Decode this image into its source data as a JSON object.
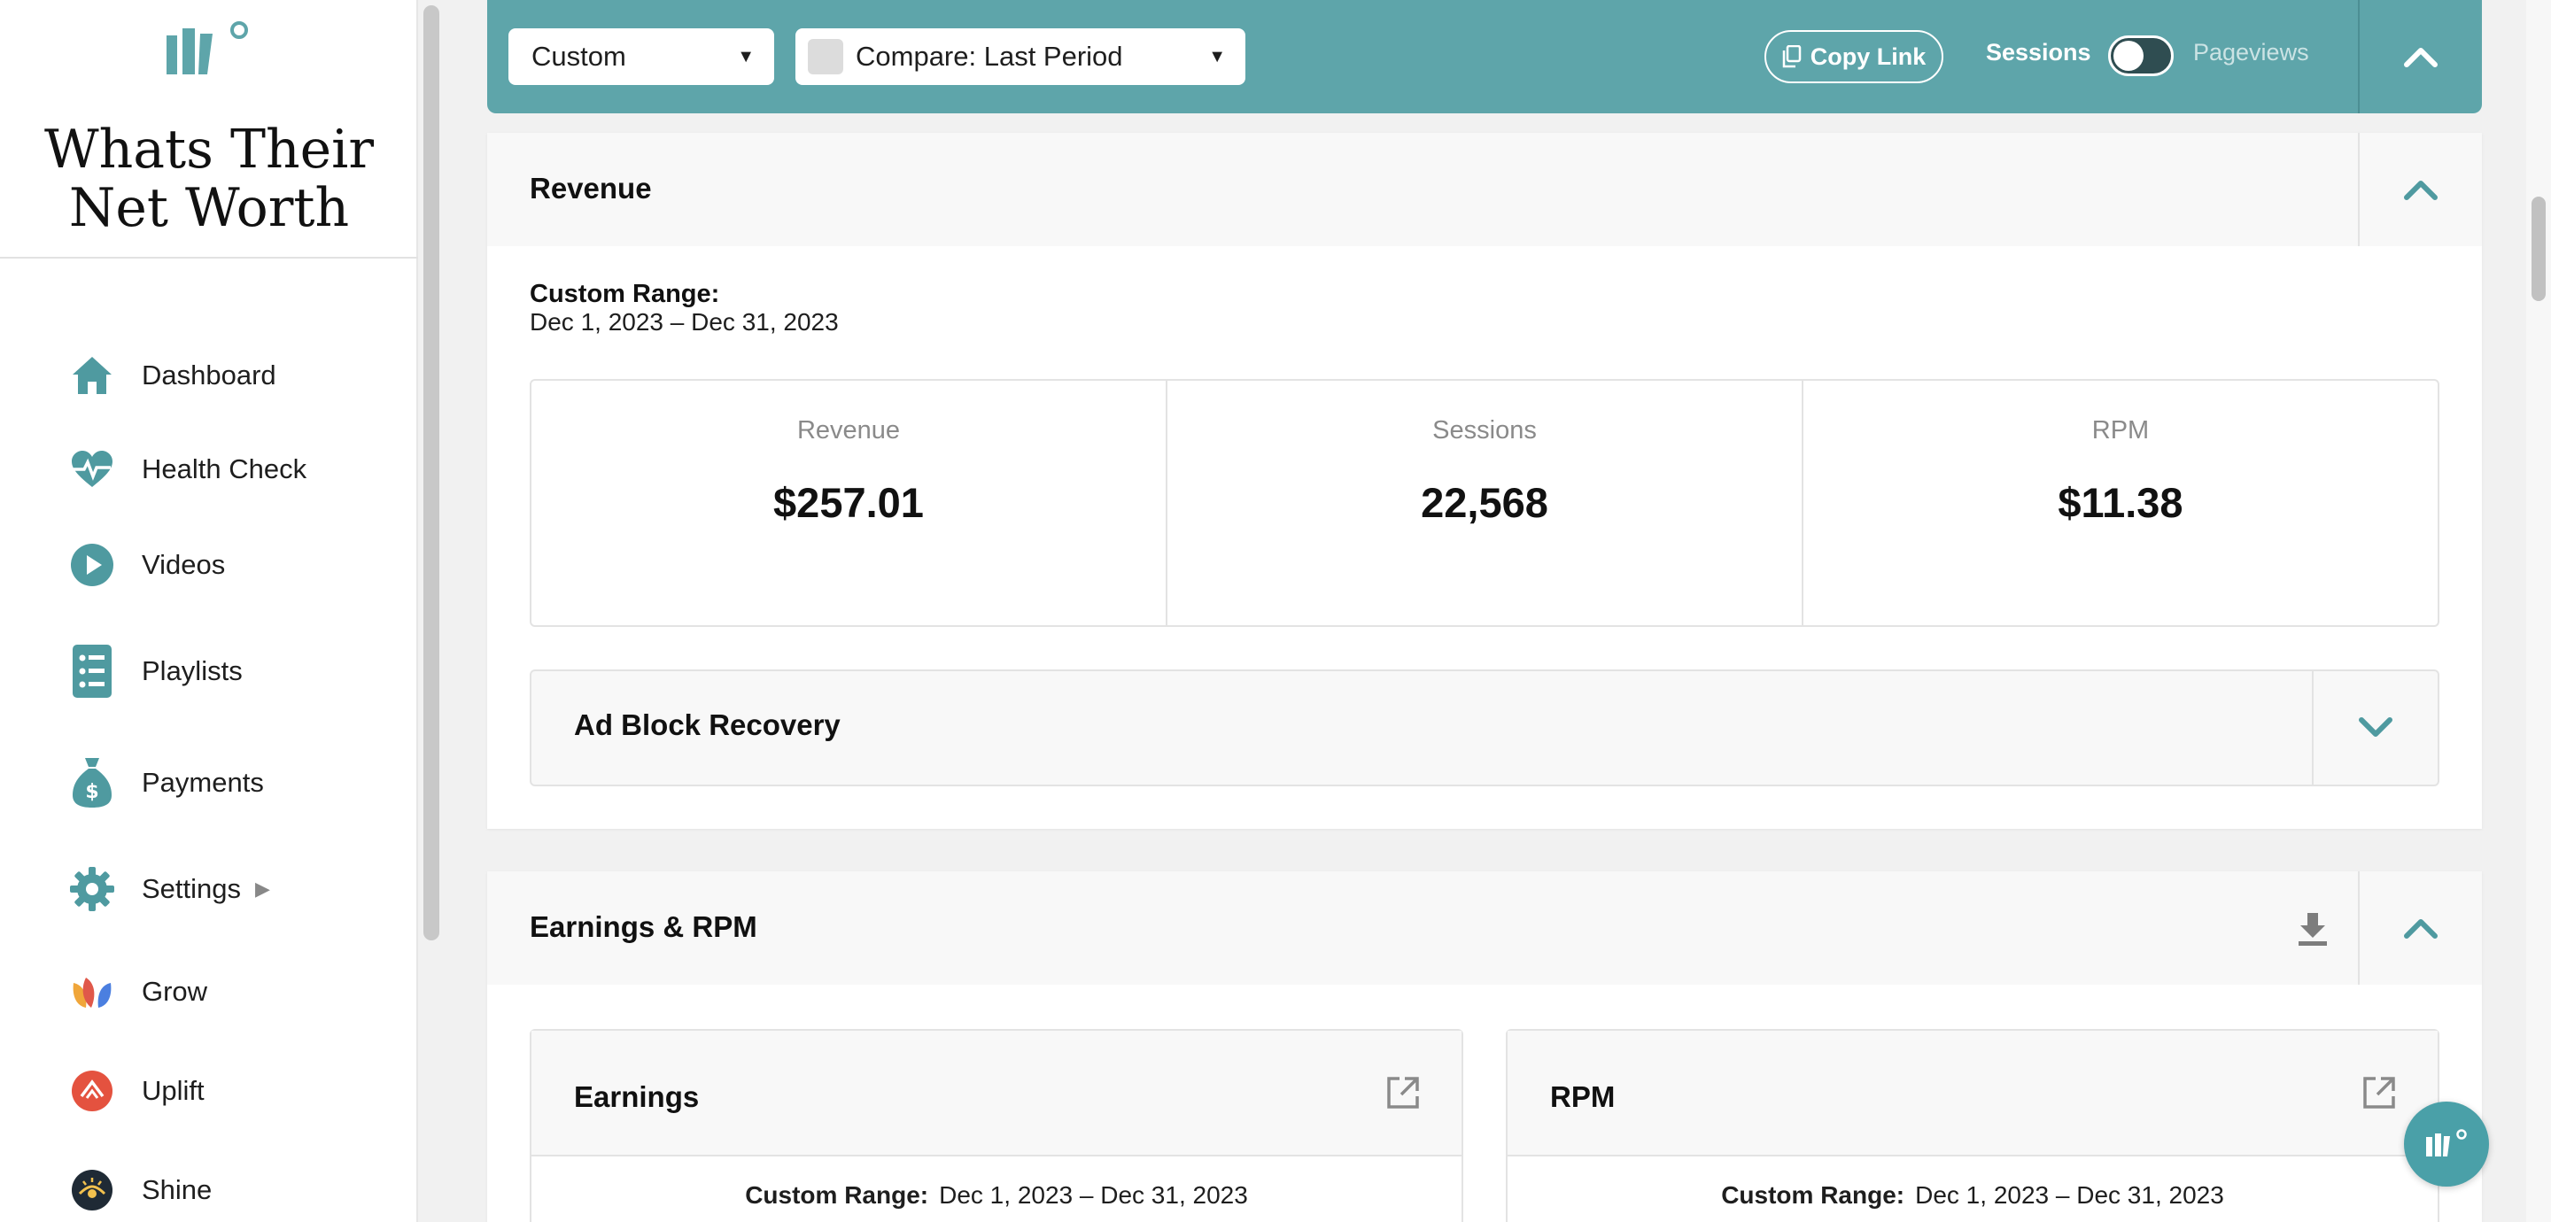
{
  "sidebar": {
    "site_name": "Whats Their\nNet Worth",
    "items": [
      {
        "label": "Dashboard",
        "icon": "home-icon"
      },
      {
        "label": "Health Check",
        "icon": "heartbeat-icon"
      },
      {
        "label": "Videos",
        "icon": "play-icon"
      },
      {
        "label": "Playlists",
        "icon": "list-icon"
      },
      {
        "label": "Payments",
        "icon": "money-bag-icon"
      },
      {
        "label": "Settings",
        "icon": "gear-icon"
      },
      {
        "label": "Grow",
        "icon": "grow-icon"
      },
      {
        "label": "Uplift",
        "icon": "uplift-icon"
      },
      {
        "label": "Shine",
        "icon": "shine-icon"
      }
    ]
  },
  "toolbar": {
    "range_select": "Custom",
    "compare_select": "Compare: Last Period",
    "copy_link": "Copy Link",
    "toggle_left": "Sessions",
    "toggle_right": "Pageviews"
  },
  "revenue_panel": {
    "title": "Revenue",
    "range_label": "Custom Range:",
    "range_value": "Dec 1, 2023 – Dec 31, 2023",
    "metrics": [
      {
        "label": "Revenue",
        "value": "$257.01"
      },
      {
        "label": "Sessions",
        "value": "22,568"
      },
      {
        "label": "RPM",
        "value": "$11.38"
      }
    ],
    "ad_block_title": "Ad Block Recovery"
  },
  "earnings_panel": {
    "title": "Earnings & RPM",
    "cards": [
      {
        "title": "Earnings",
        "range_label": "Custom Range:",
        "range_value": "Dec 1, 2023 – Dec 31, 2023"
      },
      {
        "title": "RPM",
        "range_label": "Custom Range:",
        "range_value": "Dec 1, 2023 – Dec 31, 2023"
      }
    ]
  },
  "colors": {
    "accent": "#5ea5aa",
    "accent_dark": "#4aa0a8",
    "text": "#1b1b1b",
    "muted": "#8a8a8a"
  }
}
